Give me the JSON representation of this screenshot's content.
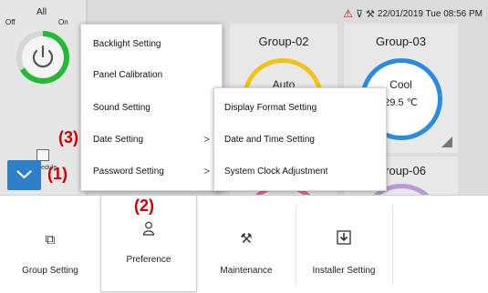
{
  "status_bar": {
    "datetime": "22/01/2019 Tue 08:56 PM"
  },
  "all_control": {
    "title": "All",
    "off_label": "Off",
    "on_label": "On"
  },
  "schedule": {
    "label": "Schedule"
  },
  "groups": [
    {
      "name": "Group-02",
      "mode": "Auto",
      "temperature": ""
    },
    {
      "name": "Group-03",
      "mode": "Cool",
      "temperature": "29.5 ℃"
    },
    {
      "name": "Group-06",
      "mode": "",
      "temperature": ""
    }
  ],
  "preference_menu": [
    {
      "label": "Backlight Setting",
      "has_submenu": false
    },
    {
      "label": "Panel Calibration",
      "has_submenu": false
    },
    {
      "label": "Sound Setting",
      "has_submenu": false
    },
    {
      "label": "Date Setting",
      "has_submenu": true,
      "arrow": ">"
    },
    {
      "label": "Password Setting",
      "has_submenu": true,
      "arrow": ">"
    }
  ],
  "date_submenu": [
    {
      "label": "Display Format Setting"
    },
    {
      "label": "Date and Time Setting"
    },
    {
      "label": "System Clock Adjustment"
    }
  ],
  "bottom_tabs": [
    {
      "label": "Group Setting",
      "icon": "group-setting-icon"
    },
    {
      "label": "Preference",
      "icon": "person-icon"
    },
    {
      "label": "Maintenance",
      "icon": "maintenance-tools-icon"
    },
    {
      "label": "Installer Setting",
      "icon": "download-box-icon"
    }
  ],
  "annotations": {
    "a1": "(1)",
    "a2": "(2)",
    "a3": "(3)"
  },
  "colors": {
    "accent_blue": "#2f7ec9",
    "annotation_red": "#d40000",
    "ring_green": "#22bb33",
    "ring_yellow": "#f2c21a",
    "ring_blue": "#2a8ce0"
  }
}
